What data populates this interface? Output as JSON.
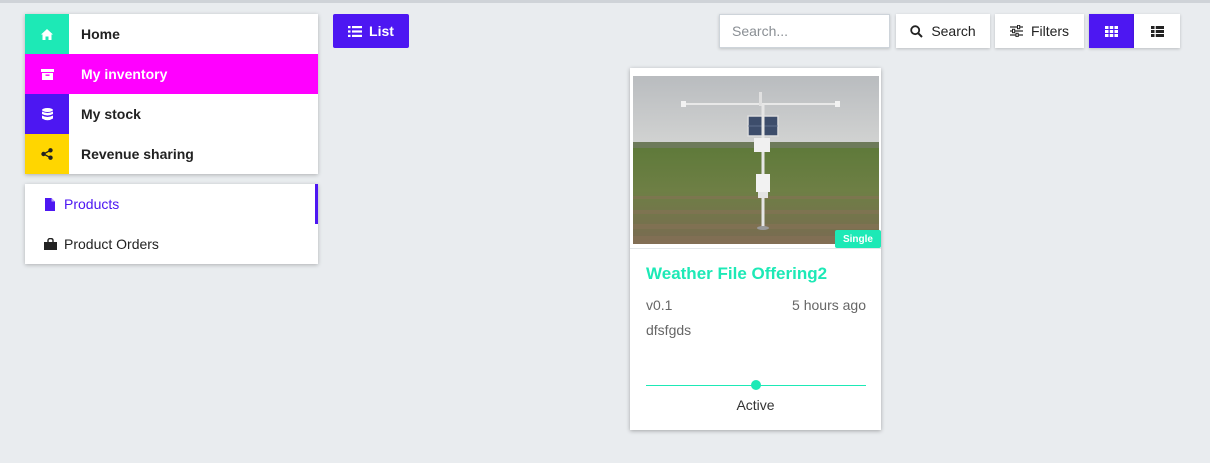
{
  "main_menu": {
    "items": [
      {
        "label": "Home",
        "icon": "home-icon",
        "color": "#1de9b6",
        "active": false
      },
      {
        "label": "My inventory",
        "icon": "archive-icon",
        "color": "#ff00ff",
        "active": true
      },
      {
        "label": "My stock",
        "icon": "database-icon",
        "color": "#4d17f2",
        "active": false
      },
      {
        "label": "Revenue sharing",
        "icon": "share-icon",
        "color": "#ffd600",
        "active": false
      }
    ]
  },
  "sub_menu": {
    "items": [
      {
        "label": "Products",
        "icon": "file-icon",
        "active": true
      },
      {
        "label": "Product Orders",
        "icon": "shopping-bag-icon",
        "active": false
      }
    ]
  },
  "toolbar": {
    "list_label": "List",
    "search_placeholder": "Search...",
    "search_value": "",
    "search_label": "Search",
    "filters_label": "Filters",
    "view_mode": "grid"
  },
  "colors": {
    "primary": "#4d17f2",
    "accent": "#1de9b6",
    "magenta": "#ff00ff",
    "yellow": "#ffd600",
    "background": "#e9ecef"
  },
  "offerings": [
    {
      "badge": "Single",
      "title": "Weather File Offering2",
      "version": "v0.1",
      "time": "5 hours ago",
      "description": "dfsfgds",
      "status": "Active",
      "image": "weather-station-in-field"
    }
  ]
}
